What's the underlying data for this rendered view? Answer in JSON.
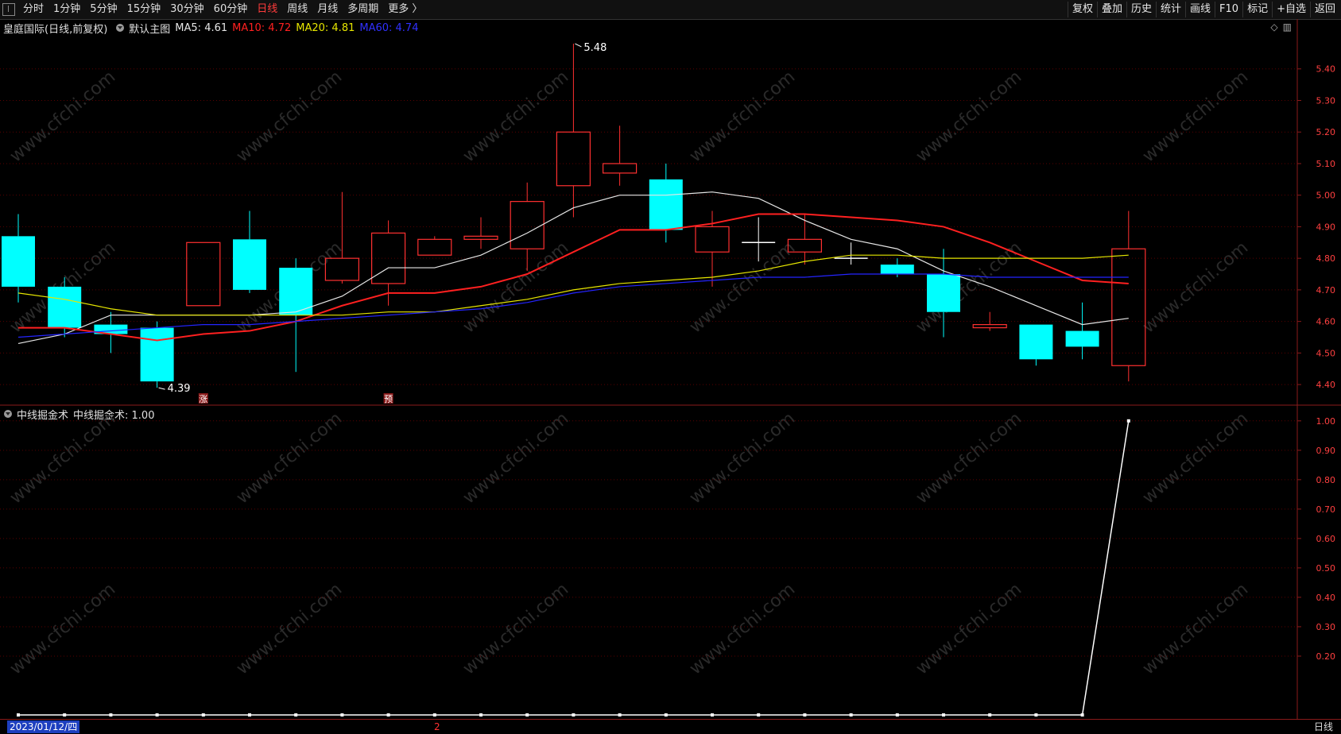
{
  "toolbar": {
    "periods": [
      {
        "label": "分时",
        "active": false
      },
      {
        "label": "1分钟",
        "active": false
      },
      {
        "label": "5分钟",
        "active": false
      },
      {
        "label": "15分钟",
        "active": false
      },
      {
        "label": "30分钟",
        "active": false
      },
      {
        "label": "60分钟",
        "active": false
      },
      {
        "label": "日线",
        "active": true
      },
      {
        "label": "周线",
        "active": false
      },
      {
        "label": "月线",
        "active": false
      },
      {
        "label": "多周期",
        "active": false
      },
      {
        "label": "更多 〉",
        "active": false
      }
    ],
    "right_buttons": [
      "复权",
      "叠加",
      "历史",
      "统计",
      "画线",
      "F10",
      "标记",
      "+自选",
      "返回"
    ]
  },
  "main_chart": {
    "stock_title": "皇庭国际(日线,前复权)",
    "main_chart_label": "默认主图",
    "ma_labels": [
      {
        "text": "MA5: 4.61",
        "color": "#e6e6e6"
      },
      {
        "text": "MA10: 4.72",
        "color": "#ff2020"
      },
      {
        "text": "MA20: 4.81",
        "color": "#e6e600"
      },
      {
        "text": "MA60: 4.74",
        "color": "#3030ff"
      }
    ],
    "high_marker": "5.48",
    "low_marker": "4.39",
    "event_markers": [
      "涨",
      "预"
    ],
    "watermark": "www.cfchi.com"
  },
  "indicator": {
    "name": "中线掘金术",
    "value_label": "中线掘金术: 1.00"
  },
  "bottom": {
    "date": "2023/01/12/四",
    "month_mark": "2",
    "period": "日线"
  },
  "colors": {
    "up": "#ff3030",
    "down": "#00ffff",
    "ma5": "#e6e6e6",
    "ma10": "#ff2020",
    "ma20": "#e6e600",
    "ma60": "#2424ff",
    "grid": "#5a0000"
  },
  "chart_data": [
    {
      "type": "candlestick",
      "title": "皇庭国际(日线,前复权)",
      "y_ticks": [
        4.4,
        4.5,
        4.6,
        4.7,
        4.8,
        4.9,
        5.0,
        5.1,
        5.2,
        5.3,
        5.4
      ],
      "ylim": [
        4.36,
        5.5
      ],
      "candles": [
        {
          "o": 4.87,
          "h": 4.94,
          "l": 4.66,
          "c": 4.71
        },
        {
          "o": 4.71,
          "h": 4.74,
          "l": 4.55,
          "c": 4.58
        },
        {
          "o": 4.59,
          "h": 4.63,
          "l": 4.5,
          "c": 4.56
        },
        {
          "o": 4.58,
          "h": 4.6,
          "l": 4.39,
          "c": 4.41
        },
        {
          "o": 4.65,
          "h": 4.85,
          "l": 4.65,
          "c": 4.85
        },
        {
          "o": 4.86,
          "h": 4.95,
          "l": 4.69,
          "c": 4.7
        },
        {
          "o": 4.77,
          "h": 4.8,
          "l": 4.44,
          "c": 4.62
        },
        {
          "o": 4.73,
          "h": 5.01,
          "l": 4.72,
          "c": 4.8
        },
        {
          "o": 4.72,
          "h": 4.92,
          "l": 4.65,
          "c": 4.88
        },
        {
          "o": 4.81,
          "h": 4.87,
          "l": 4.81,
          "c": 4.86
        },
        {
          "o": 4.86,
          "h": 4.93,
          "l": 4.83,
          "c": 4.87
        },
        {
          "o": 4.83,
          "h": 5.04,
          "l": 4.76,
          "c": 4.98
        },
        {
          "o": 5.03,
          "h": 5.48,
          "l": 4.93,
          "c": 5.2
        },
        {
          "o": 5.07,
          "h": 5.22,
          "l": 5.03,
          "c": 5.1
        },
        {
          "o": 5.05,
          "h": 5.1,
          "l": 4.85,
          "c": 4.89
        },
        {
          "o": 4.82,
          "h": 4.95,
          "l": 4.71,
          "c": 4.9
        },
        {
          "o": 4.85,
          "h": 4.93,
          "l": 4.79,
          "c": 4.85
        },
        {
          "o": 4.82,
          "h": 4.94,
          "l": 4.78,
          "c": 4.86
        },
        {
          "o": 4.8,
          "h": 4.85,
          "l": 4.78,
          "c": 4.8
        },
        {
          "o": 4.78,
          "h": 4.8,
          "l": 4.74,
          "c": 4.75
        },
        {
          "o": 4.75,
          "h": 4.83,
          "l": 4.55,
          "c": 4.63
        },
        {
          "o": 4.58,
          "h": 4.63,
          "l": 4.57,
          "c": 4.59
        },
        {
          "o": 4.59,
          "h": 4.59,
          "l": 4.46,
          "c": 4.48
        },
        {
          "o": 4.57,
          "h": 4.66,
          "l": 4.48,
          "c": 4.52
        },
        {
          "o": 4.46,
          "h": 4.95,
          "l": 4.41,
          "c": 4.83
        }
      ],
      "series": [
        {
          "name": "MA5",
          "values": [
            4.53,
            4.56,
            4.62,
            4.62,
            4.62,
            4.62,
            4.63,
            4.68,
            4.77,
            4.77,
            4.81,
            4.88,
            4.96,
            5.0,
            5.0,
            5.01,
            4.99,
            4.92,
            4.86,
            4.83,
            4.76,
            4.71,
            4.65,
            4.59,
            4.61
          ]
        },
        {
          "name": "MA10",
          "values": [
            4.58,
            4.58,
            4.56,
            4.54,
            4.56,
            4.57,
            4.6,
            4.65,
            4.69,
            4.69,
            4.71,
            4.75,
            4.82,
            4.89,
            4.89,
            4.91,
            4.94,
            4.94,
            4.93,
            4.92,
            4.9,
            4.85,
            4.79,
            4.73,
            4.72
          ]
        },
        {
          "name": "MA20",
          "values": [
            4.69,
            4.67,
            4.64,
            4.62,
            4.62,
            4.62,
            4.62,
            4.62,
            4.63,
            4.63,
            4.65,
            4.67,
            4.7,
            4.72,
            4.73,
            4.74,
            4.76,
            4.79,
            4.81,
            4.81,
            4.8,
            4.8,
            4.8,
            4.8,
            4.81
          ]
        },
        {
          "name": "MA60",
          "values": [
            4.55,
            4.56,
            4.57,
            4.58,
            4.59,
            4.59,
            4.6,
            4.61,
            4.62,
            4.63,
            4.64,
            4.66,
            4.69,
            4.71,
            4.72,
            4.73,
            4.74,
            4.74,
            4.75,
            4.75,
            4.75,
            4.74,
            4.74,
            4.74,
            4.74
          ]
        }
      ]
    },
    {
      "type": "line",
      "title": "中线掘金术",
      "y_ticks": [
        0.2,
        0.3,
        0.4,
        0.5,
        0.6,
        0.7,
        0.8,
        0.9,
        1.0
      ],
      "ylim": [
        0.0,
        1.04
      ],
      "series": [
        {
          "name": "中线掘金术",
          "values": [
            0,
            0,
            0,
            0,
            0,
            0,
            0,
            0,
            0,
            0,
            0,
            0,
            0,
            0,
            0,
            0,
            0,
            0,
            0,
            0,
            0,
            0,
            0,
            0,
            1.0
          ]
        }
      ]
    }
  ]
}
